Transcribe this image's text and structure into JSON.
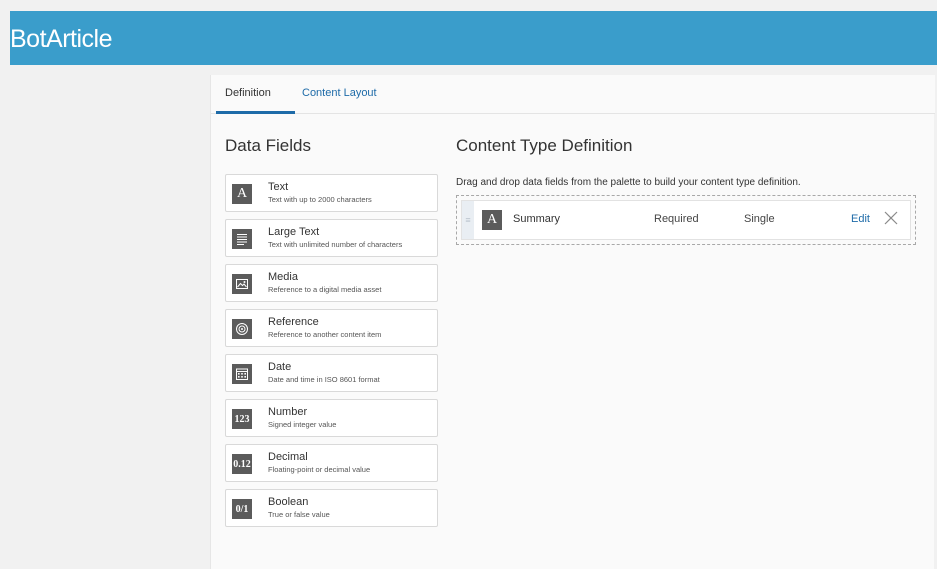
{
  "app": {
    "title": "BotArticle"
  },
  "tabs": [
    {
      "label": "Definition"
    },
    {
      "label": "Content Layout"
    }
  ],
  "data_fields": {
    "title": "Data Fields",
    "items": [
      {
        "icon": "text-icon",
        "glyph": "A",
        "name": "Text",
        "description": "Text with up to 2000 characters"
      },
      {
        "icon": "large-text-icon",
        "glyph": "",
        "name": "Large Text",
        "description": "Text with unlimited number of characters"
      },
      {
        "icon": "media-icon",
        "glyph": "",
        "name": "Media",
        "description": "Reference to a digital media asset"
      },
      {
        "icon": "reference-icon",
        "glyph": "",
        "name": "Reference",
        "description": "Reference to another content item"
      },
      {
        "icon": "date-icon",
        "glyph": "",
        "name": "Date",
        "description": "Date and time in ISO 8601 format"
      },
      {
        "icon": "number-icon",
        "glyph": "123",
        "name": "Number",
        "description": "Signed integer value"
      },
      {
        "icon": "decimal-icon",
        "glyph": "0.12",
        "name": "Decimal",
        "description": "Floating-point or decimal value"
      },
      {
        "icon": "boolean-icon",
        "glyph": "0/1",
        "name": "Boolean",
        "description": "True or false value"
      }
    ]
  },
  "content_type_definition": {
    "title": "Content Type Definition",
    "instructions": "Drag and drop data fields from the palette to build your content type definition.",
    "rows": [
      {
        "icon": "text-icon",
        "glyph": "A",
        "name": "Summary",
        "required": "Required",
        "multiplicity": "Single",
        "edit_label": "Edit"
      }
    ]
  },
  "colors": {
    "header": "#3a9dcb",
    "accent": "#1e6ba8",
    "icon_bg": "#5b5b5b"
  }
}
